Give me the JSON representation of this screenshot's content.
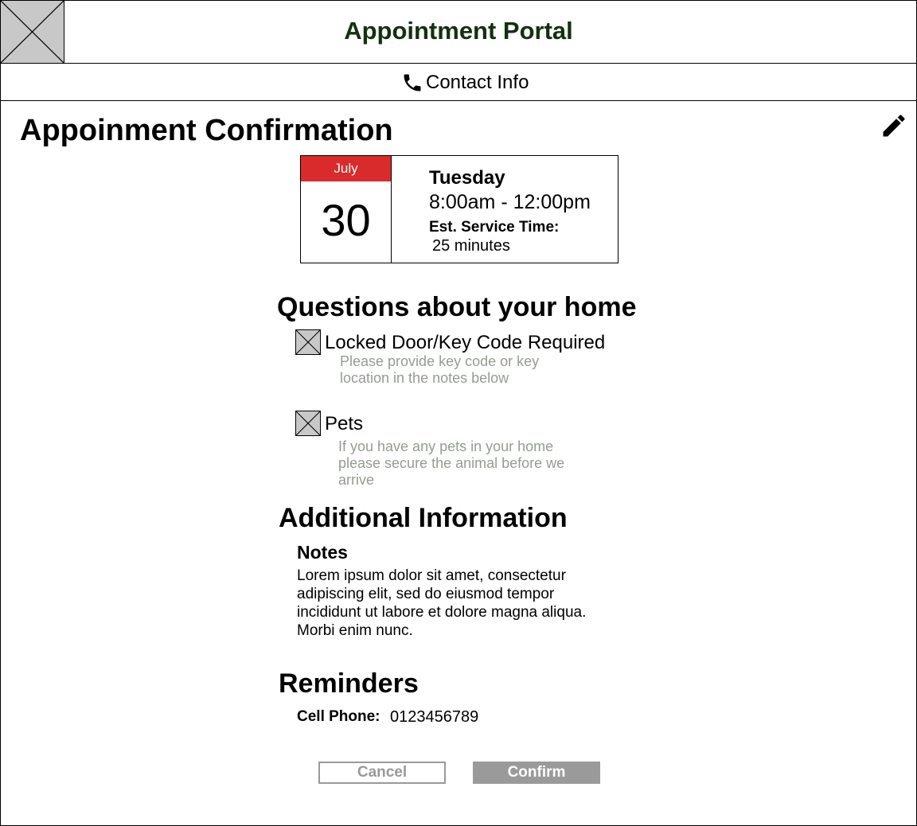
{
  "header": {
    "app_title": "Appointment Portal",
    "logo_icon": "image-placeholder-icon",
    "title_color": "#13310e"
  },
  "contact": {
    "icon": "phone-icon",
    "label": "Contact Info"
  },
  "page": {
    "title": "Appoinment Confirmation",
    "edit_icon": "pencil-icon"
  },
  "appointment": {
    "month": "July",
    "day": "30",
    "weekday": "Tuesday",
    "time_range": "8:00am - 12:00pm",
    "est_label": "Est. Service Time:",
    "est_value": "25 minutes",
    "month_color": "#d92b2b"
  },
  "questions": {
    "title": "Questions about your home",
    "items": [
      {
        "label": "Locked Door/Key Code Required",
        "hint_line1": "Please provide key code or key",
        "hint_line2": "location in the notes below"
      },
      {
        "label": "Pets",
        "hint_line1": "If you have any pets in your home",
        "hint_line2": "please secure the animal before we",
        "hint_line3": "arrive"
      }
    ]
  },
  "additional": {
    "title": "Additional Information",
    "notes_label": "Notes",
    "notes_text": "Lorem ipsum dolor sit amet, consectetur adipiscing elit, sed do eiusmod tempor incididunt ut labore et dolore magna aliqua. Morbi enim nunc."
  },
  "reminders": {
    "title": "Reminders",
    "cell_label": "Cell Phone:",
    "cell_value": "0123456789"
  },
  "actions": {
    "cancel_label": "Cancel",
    "confirm_label": "Confirm"
  }
}
